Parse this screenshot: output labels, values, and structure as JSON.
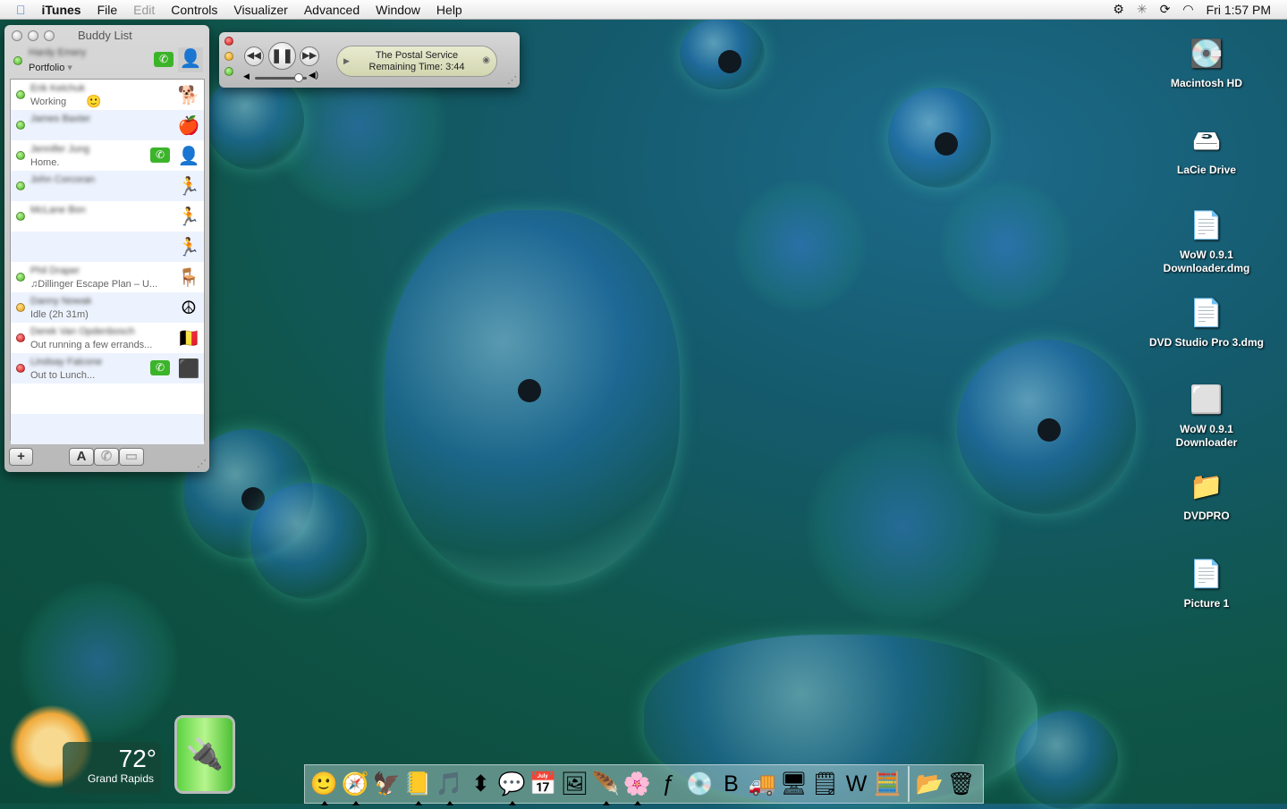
{
  "menubar": {
    "app": "iTunes",
    "items": [
      "File",
      "Edit",
      "Controls",
      "Visualizer",
      "Advanced",
      "Window",
      "Help"
    ],
    "clock": "Fri 1:57 PM",
    "status_icons": [
      "gear-icon",
      "bluetooth-icon",
      "sync-icon",
      "wifi-icon"
    ]
  },
  "buddy_list": {
    "title": "Buddy List",
    "me": {
      "name": "Hardy Emery",
      "status": "Portfolio"
    },
    "buddies": [
      {
        "name": "Erik Kelchuk",
        "status": "Working",
        "dot": "green",
        "avatar": "🐕",
        "phone": false,
        "extra": "🙂"
      },
      {
        "name": "James Baxter",
        "status": "",
        "dot": "green",
        "avatar": "🍎",
        "phone": false
      },
      {
        "name": "Jennifer Jung",
        "status": "Home.",
        "dot": "green",
        "avatar": "👤",
        "phone": true
      },
      {
        "name": "John Corcoran",
        "status": "",
        "dot": "green",
        "avatar": "🏃",
        "phone": false
      },
      {
        "name": "McLane Bon",
        "status": "",
        "dot": "green",
        "avatar": "🏃",
        "phone": false
      },
      {
        "name": "",
        "status": "",
        "dot": "",
        "avatar": "🏃",
        "phone": false
      },
      {
        "name": "Phil Draper",
        "status": "♫Dillinger Escape Plan – U...",
        "dot": "green",
        "avatar": "🪑",
        "phone": false
      },
      {
        "name": "Danny Nowak",
        "status": "Idle (2h 31m)",
        "dot": "orange",
        "avatar": "☮",
        "phone": false
      },
      {
        "name": "Derek Van Opdenbosch",
        "status": "Out running a few errands...",
        "dot": "red",
        "avatar": "🇧🇪",
        "phone": false
      },
      {
        "name": "Lindsay Falcone",
        "status": "Out to Lunch...",
        "dot": "red",
        "avatar": "⬛",
        "phone": true
      }
    ],
    "buttons": {
      "add": "+",
      "text": "A"
    }
  },
  "itunes_mini": {
    "line1": "The Postal Service",
    "line2": "Remaining Time: 3:44",
    "volume": 0.85
  },
  "desktop_icons": [
    {
      "label": "Macintosh HD",
      "icon": "💽"
    },
    {
      "label": "LaCie Drive",
      "icon": "🖴"
    },
    {
      "label": "WoW 0.9.1 Downloader.dmg",
      "icon": "📄"
    },
    {
      "label": "DVD Studio Pro 3.dmg",
      "icon": "📄"
    },
    {
      "label": "WoW 0.9.1 Downloader",
      "icon": "⬜"
    },
    {
      "label": "DVDPRO",
      "icon": "📁"
    },
    {
      "label": "Picture 1",
      "icon": "📄"
    }
  ],
  "weather": {
    "temp": "72°",
    "city": "Grand Rapids"
  },
  "dock": [
    {
      "name": "finder",
      "icon": "🙂",
      "running": true
    },
    {
      "name": "safari",
      "icon": "🧭",
      "running": true
    },
    {
      "name": "mail",
      "icon": "🦅",
      "running": false
    },
    {
      "name": "address-book",
      "icon": "📒",
      "running": true
    },
    {
      "name": "itunes",
      "icon": "🎵",
      "running": true
    },
    {
      "name": "transfer",
      "icon": "⬍",
      "running": false
    },
    {
      "name": "ichat",
      "icon": "💬",
      "running": true
    },
    {
      "name": "ical",
      "icon": "📅",
      "running": false
    },
    {
      "name": "preview",
      "icon": "🖼",
      "running": false
    },
    {
      "name": "painter",
      "icon": "🪶",
      "running": true
    },
    {
      "name": "flower-app",
      "icon": "🌸",
      "running": true
    },
    {
      "name": "flash",
      "icon": "ƒ",
      "running": false
    },
    {
      "name": "dvd-player",
      "icon": "💿",
      "running": false
    },
    {
      "name": "bbedit",
      "icon": "B",
      "running": false
    },
    {
      "name": "transmit",
      "icon": "🚚",
      "running": false
    },
    {
      "name": "classic",
      "icon": "🖥",
      "running": false
    },
    {
      "name": "stickies",
      "icon": "🗒",
      "running": false
    },
    {
      "name": "word",
      "icon": "W",
      "running": false
    },
    {
      "name": "calculator",
      "icon": "🧮",
      "running": false
    }
  ],
  "dock_right": [
    {
      "name": "applications-folder",
      "icon": "📂"
    },
    {
      "name": "trash",
      "icon": "🗑"
    }
  ]
}
